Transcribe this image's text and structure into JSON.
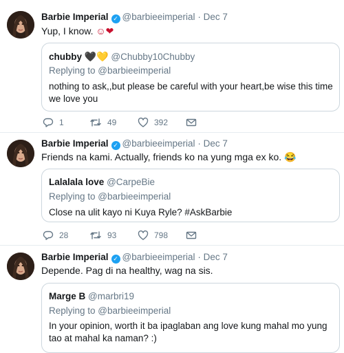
{
  "tweets": [
    {
      "author": "Barbie Imperial",
      "handle": "@barbieeimperial",
      "sep": "·",
      "date": "Dec 7",
      "text": "Yup, I know.",
      "emoji": "☺❤",
      "quote": {
        "author": "chubby",
        "author_emoji": "🖤💛",
        "handle": "@Chubby10Chubby",
        "replying": "Replying to @barbieeimperial",
        "text": "nothing to ask,,but please be careful with your heart,be wise this time we love you"
      },
      "replies": "1",
      "retweets": "49",
      "likes": "392"
    },
    {
      "author": "Barbie Imperial",
      "handle": "@barbieeimperial",
      "sep": "·",
      "date": "Dec 7",
      "text": "Friends na kami. Actually, friends ko na yung mga ex ko.",
      "emoji": "😂",
      "quote": {
        "author": "Lalalala love",
        "handle": "@CarpeBie",
        "replying": "Replying to @barbieeimperial",
        "text": "Close na ulit kayo ni Kuya Ryle? #AskBarbie"
      },
      "replies": "28",
      "retweets": "93",
      "likes": "798"
    },
    {
      "author": "Barbie Imperial",
      "handle": "@barbieeimperial",
      "sep": "·",
      "date": "Dec 7",
      "text": "Depende. Pag di na healthy, wag na sis.",
      "quote": {
        "author": "Marge B",
        "handle": "@marbri19",
        "replying": "Replying to @barbieeimperial",
        "text": "In your opinion, worth it ba ipaglaban ang love kung mahal mo yung tao at mahal ka naman? :)"
      }
    }
  ],
  "icons": {
    "reply": "reply-icon",
    "retweet": "retweet-icon",
    "like": "heart-icon",
    "dm": "envelope-icon",
    "verified": "verified-badge-icon"
  },
  "colors": {
    "verified": "#1da1f2",
    "muted": "#657786",
    "border": "#ccd6dd"
  }
}
